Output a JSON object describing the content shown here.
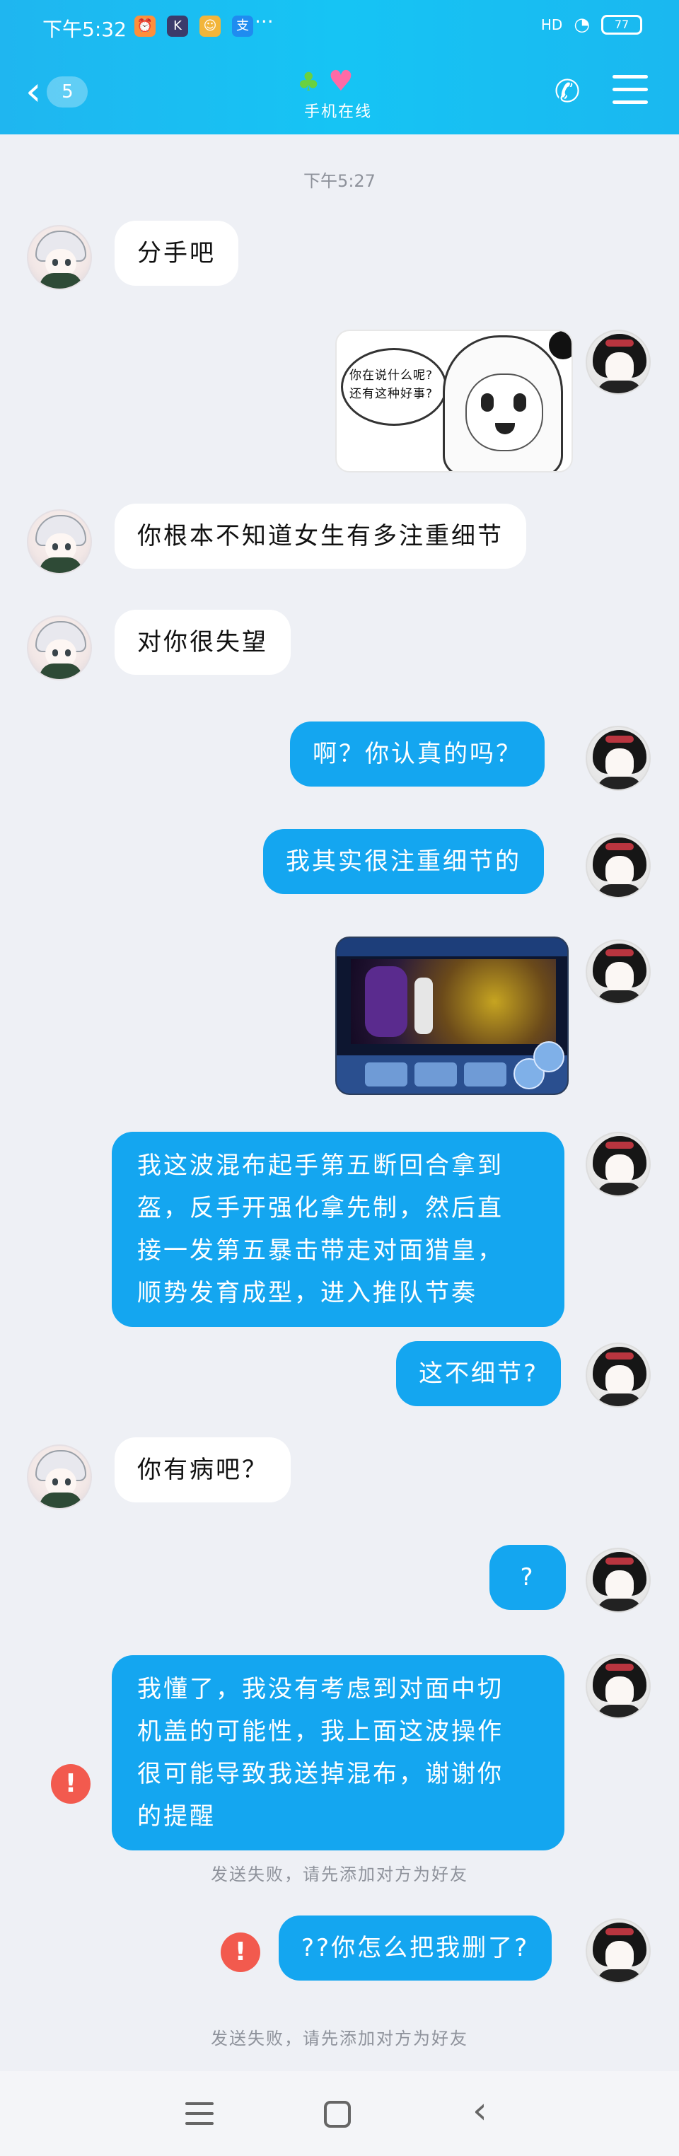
{
  "status_bar": {
    "time": "下午5:32",
    "dots": "···",
    "battery": "77",
    "signal": "HD"
  },
  "header": {
    "unread_count": "5",
    "subtitle": "手机在线"
  },
  "messages": {
    "timestamp": "下午5:27",
    "m1": "分手吧",
    "meme_text": "你在说什么呢?\n还有这种好事?",
    "m3": "你根本不知道女生有多注重细节",
    "m4": "对你很失望",
    "m5": "啊？你认真的吗？",
    "m6": "我其实很注重细节的",
    "m8_line1": "我这波混布起手第五断回合拿到",
    "m8_line2": "盔，反手开强化拿先制，然后直",
    "m8_line3": "接一发第五暴击带走对面猎皇，",
    "m8_line4": "顺势发育成型，进入推队节奏",
    "m9": "这不细节?",
    "m10": "你有病吧？",
    "m11": "?",
    "m12_line1": "我懂了，我没有考虑到对面中切",
    "m12_line2": "机盖的可能性，我上面这波操作",
    "m12_line3": "很可能导致我送掉混布，谢谢你",
    "m12_line4": "的提醒",
    "fail_note_1": "发送失败，请先添加对方为好友",
    "m13": "??你怎么把我删了?",
    "fail_note_2": "发送失败，请先添加对方为好友",
    "fail_icon": "!"
  },
  "colors": {
    "header": "#1fb6f0",
    "outgoing_bubble": "#14a6f0",
    "incoming_bubble": "#ffffff",
    "fail": "#f25a4e",
    "background": "#eef0f5"
  },
  "icons": [
    "back-chevron-icon",
    "phone-icon",
    "menu-icon",
    "clover-icon",
    "heart-icon",
    "send-fail-icon"
  ]
}
